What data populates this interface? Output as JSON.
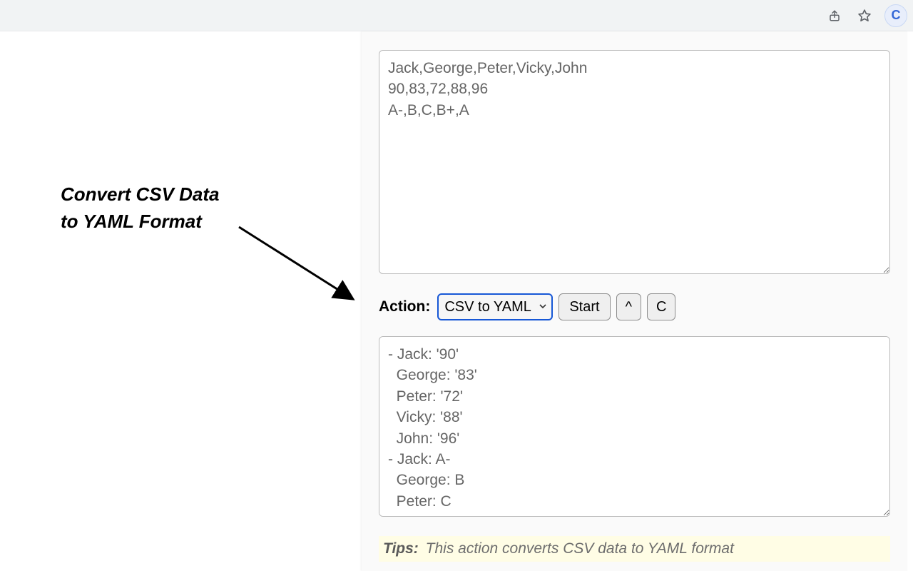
{
  "browser": {
    "ext_letter": "C"
  },
  "annotation": {
    "line1": "Convert CSV Data",
    "line2": "to YAML Format"
  },
  "popup": {
    "input_text": "Jack,George,Peter,Vicky,John\n90,83,72,88,96\nA-,B,C,B+,A",
    "action_label": "Action:",
    "action_select": "CSV to YAML",
    "start_button": "Start",
    "caret_button": "^",
    "c_button": "C",
    "output_text": "- Jack: '90'\n  George: '83'\n  Peter: '72'\n  Vicky: '88'\n  John: '96'\n- Jack: A-\n  George: B\n  Peter: C",
    "tips_label": "Tips:",
    "tips_text": "This action converts CSV data to YAML format"
  }
}
